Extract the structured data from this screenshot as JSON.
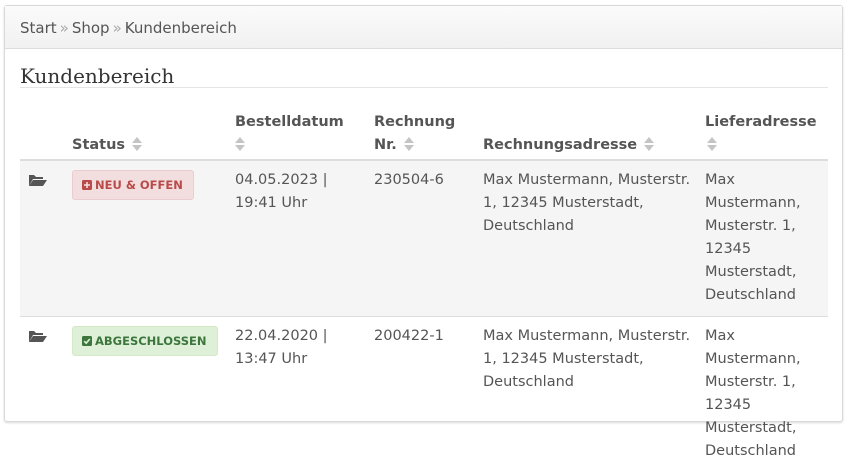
{
  "breadcrumb": {
    "items": [
      "Start",
      "Shop",
      "Kundenbereich"
    ],
    "separator": "»"
  },
  "page": {
    "title": "Kundenbereich"
  },
  "table": {
    "headers": {
      "status": "Status",
      "date": "Bestelldatum",
      "invoice_line1": "Rechnung",
      "invoice_line2": "Nr.",
      "billing": "Rechnungsadresse",
      "shipping": "Lieferadresse"
    },
    "rows": [
      {
        "icon": "folder-open-icon",
        "status": "NEU & OFFEN",
        "status_icon": "plus-square-icon",
        "status_color": "#b94a48",
        "date": "04.05.2023 |",
        "time": "19:41 Uhr",
        "invoice": "230504-6",
        "billing": "Max Mustermann, Musterstr. 1, 12345 Musterstadt, Deutschland",
        "shipping": "Max Mustermann, Musterstr. 1, 12345 Musterstadt, Deutschland"
      },
      {
        "icon": "folder-open-icon",
        "status": "ABGESCHLOSSEN",
        "status_icon": "check-square-icon",
        "status_color": "#3c763d",
        "date": "22.04.2020 |",
        "time": "13:47 Uhr",
        "invoice": "200422-1",
        "billing": "Max Mustermann, Musterstr. 1, 12345 Musterstadt, Deutschland",
        "shipping": "Max Mustermann, Musterstr. 1, 12345 Musterstadt, Deutschland"
      }
    ]
  }
}
